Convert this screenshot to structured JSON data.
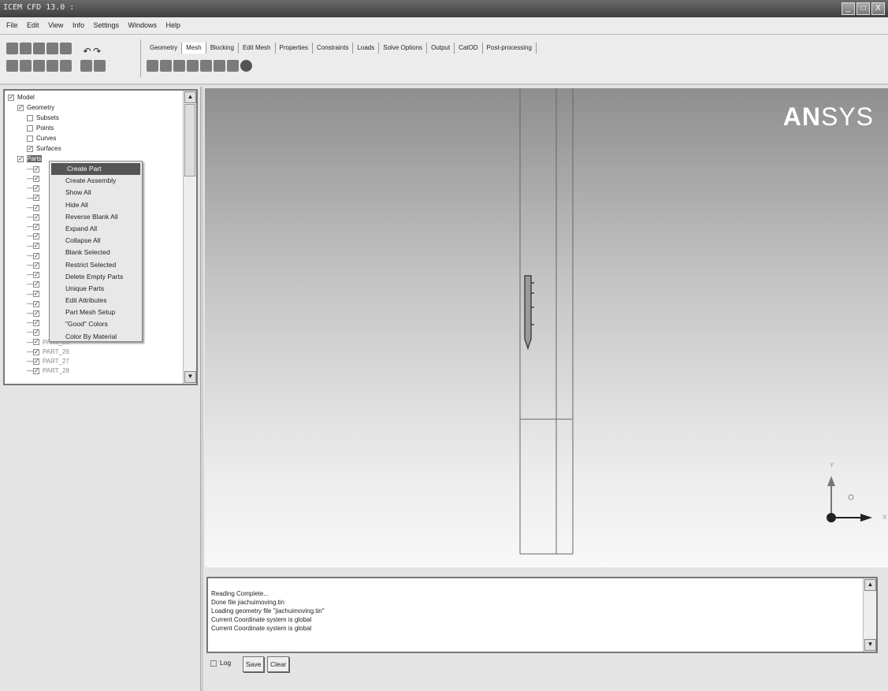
{
  "title": "ICEM CFD 13.0 :",
  "window_buttons": [
    "_",
    "□",
    "X"
  ],
  "menu": [
    "File",
    "Edit",
    "View",
    "Info",
    "Settings",
    "Windows",
    "Help"
  ],
  "tabs": [
    "Geometry",
    "Mesh",
    "Blocking",
    "Edit Mesh",
    "Properties",
    "Constraints",
    "Loads",
    "Solve Options",
    "Output",
    "CatOD",
    "Post-processing"
  ],
  "tree": {
    "items": [
      {
        "label": "Model",
        "checked": true,
        "indent": 0
      },
      {
        "label": "Geometry",
        "checked": true,
        "indent": 1
      },
      {
        "label": "Subsets",
        "checked": false,
        "indent": 2
      },
      {
        "label": "Points",
        "checked": false,
        "indent": 2
      },
      {
        "label": "Curves",
        "checked": false,
        "indent": 2
      },
      {
        "label": "Surfaces",
        "checked": true,
        "indent": 2
      },
      {
        "label": "Parts",
        "checked": true,
        "indent": 1
      }
    ],
    "parts": [
      "",
      "",
      "",
      "",
      "",
      "",
      "",
      "",
      "",
      "",
      "",
      "",
      "",
      "",
      "",
      "",
      "",
      "",
      "PART_25",
      "PART_26",
      "PART_27",
      "PART_28"
    ]
  },
  "context_menu": [
    "Create Part",
    "Create Assembly",
    "Show All",
    "Hide All",
    "Reverse Blank All",
    "Expand All",
    "Collapse All",
    "Blank Selected",
    "Restrict Selected",
    "Delete Empty Parts",
    "Unique Parts",
    "Edit Attributes",
    "Part Mesh Setup",
    "\"Good\" Colors",
    "Color By Material"
  ],
  "logo": {
    "bold": "AN",
    "rest": "SYS"
  },
  "axes": {
    "y": "Y",
    "x": "X"
  },
  "messages": [
    "Reading Complete...",
    "Done file jiachuimoving.tin",
    "Loading geometry file \"jiachuimoving.tin\"",
    "Current Coordinate system is global",
    "Current Coordinate system is global"
  ],
  "log_label": "Log",
  "save_label": "Save",
  "clear_label": "Clear"
}
